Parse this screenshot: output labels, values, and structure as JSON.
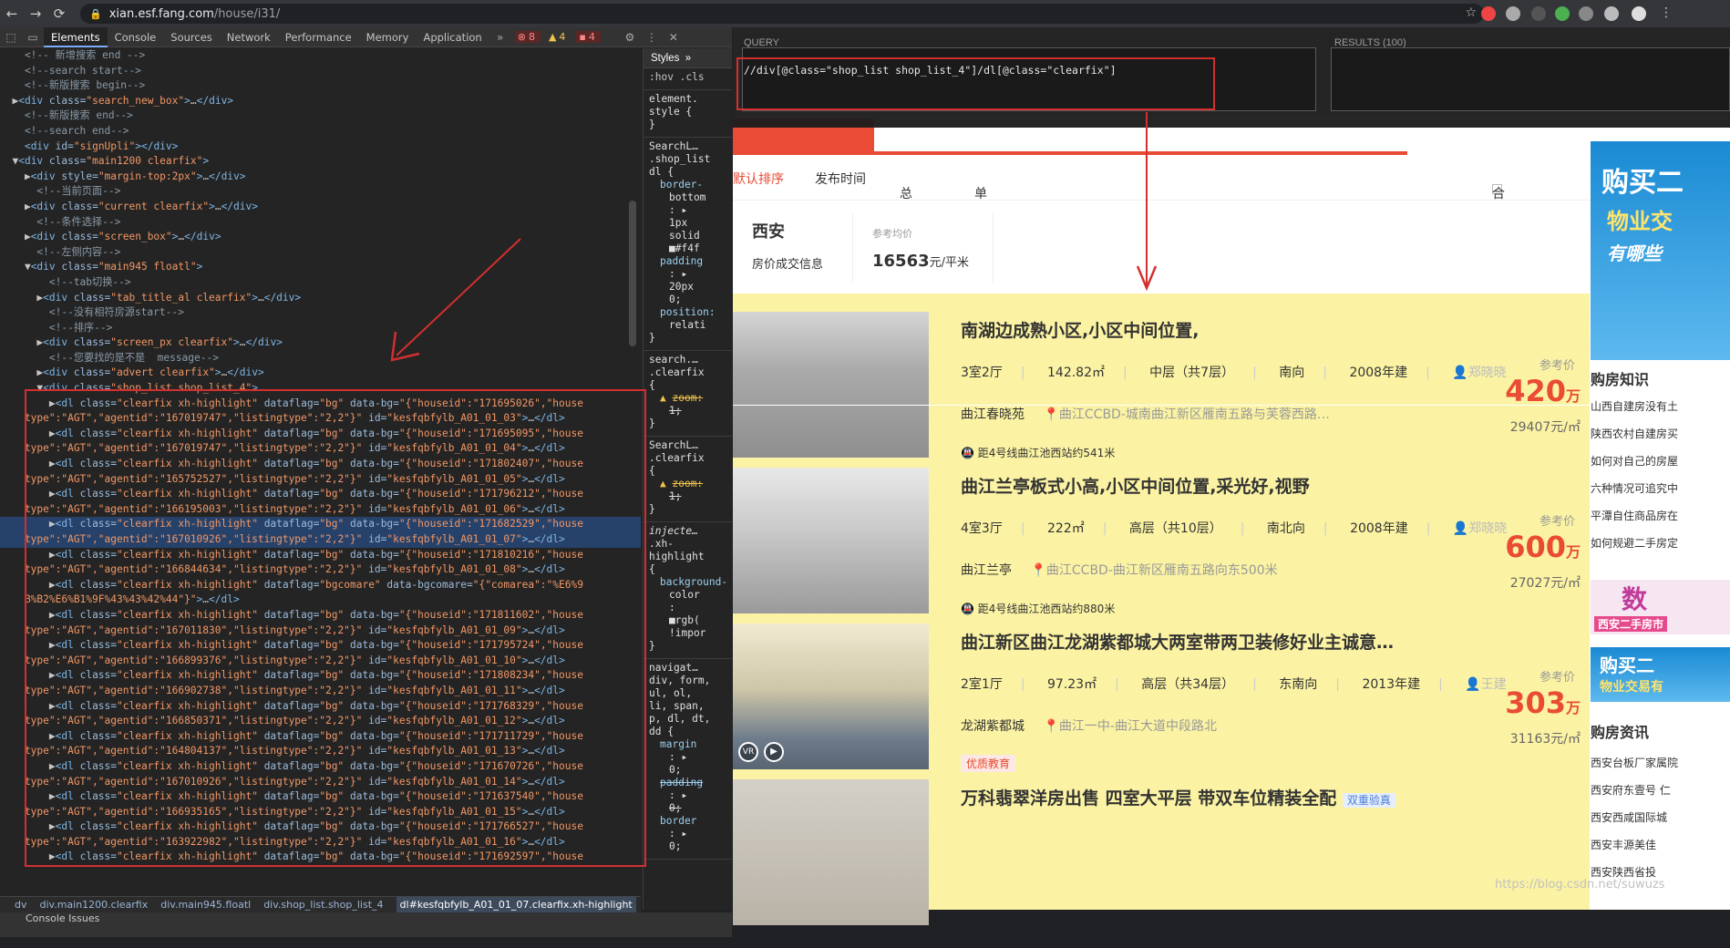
{
  "browser": {
    "url_host": "xian.esf.fang.com",
    "url_path": "/house/i31/"
  },
  "devtools": {
    "tabs": [
      "Elements",
      "Console",
      "Sources",
      "Network",
      "Performance",
      "Memory",
      "Application"
    ],
    "errors": "8",
    "warnings": "4",
    "issues": "4",
    "styles_tab": "Styles",
    "styles_toolbar": ":hov .cls",
    "crumbs": [
      "dv",
      "div.main1200.clearfix",
      "div.main945.floatl",
      "div.shop_list.shop_list_4",
      "dl#kesfqbfylb_A01_01_07.clearfix.xh-highlight"
    ],
    "console_tabs": "Console   Issues"
  },
  "xpath_helper": {
    "query_label": "QUERY",
    "results_label": "RESULTS (100)",
    "query": "//div[@class=\"shop_list shop_list_4\"]/dl[@class=\"clearfix\"]"
  },
  "page": {
    "sort_items": [
      "默认排序",
      "发布时间",
      "总价",
      "单价"
    ],
    "merge_label": "合并相似房源",
    "city": "西安",
    "deal_info": "房价成交信息",
    "avg_label": "参考均价",
    "avg_value": "16563",
    "avg_unit": "元/平米",
    "price_label": "参考价",
    "listings": [
      {
        "title": "南湖边成熟小区,小区中间位置,",
        "layout": "3室2厅",
        "area": "142.82㎡",
        "floor": "中层（共7层）",
        "facing": "南向",
        "year": "2008年建",
        "agent": "郑晓晓",
        "estate": "曲江春晓苑",
        "address": "曲江CCBD-城南曲江新区雁南五路与芙蓉西路…",
        "subway": "距4号线曲江池西站约541米",
        "price": "420",
        "price_unit": "万",
        "unit_price": "29407元/㎡"
      },
      {
        "title": "曲江兰亭板式小高,小区中间位置,采光好,视野",
        "layout": "4室3厅",
        "area": "222㎡",
        "floor": "高层（共10层）",
        "facing": "南北向",
        "year": "2008年建",
        "agent": "郑晓晓",
        "estate": "曲江兰亭",
        "address": "曲江CCBD-曲江新区雁南五路向东500米",
        "subway": "距4号线曲江池西站约880米",
        "price": "600",
        "price_unit": "万",
        "unit_price": "27027元/㎡"
      },
      {
        "title": "曲江新区曲江龙湖紫都城大两室带两卫装修好业主诚意…",
        "layout": "2室1厅",
        "area": "97.23㎡",
        "floor": "高层（共34层）",
        "facing": "东南向",
        "year": "2013年建",
        "agent": "王建",
        "estate": "龙湖紫都城",
        "address": "曲江一中-曲江大道中段路北",
        "tag": "优质教育",
        "price": "303",
        "price_unit": "万",
        "unit_price": "31163元/㎡"
      },
      {
        "title": "万科翡翠洋房出售 四室大平层 带双车位精装全配",
        "badge": "双重验真"
      }
    ]
  },
  "sidebar": {
    "ad1_line1": "购买二",
    "ad1_line2": "物业交",
    "ad1_line3": "有哪些",
    "knowledge_title": "购房知识",
    "knowledge_links": [
      "山西自建房没有土",
      "陕西农村自建房买",
      "如何对自己的房屋",
      "六种情况可追究中",
      "平潭自住商品房在",
      "如何规避二手房定"
    ],
    "ad2_text": "数",
    "ad2_sub": "西安二手房市",
    "ad3_line1": "购买二",
    "ad3_line2": "物业交易有",
    "news_title": "购房资讯",
    "news_links": [
      "西安台板厂家属院",
      "西安府东壹号 仁",
      "西安西咸国际城",
      "西安丰源美佳",
      "西安陕西省投"
    ]
  },
  "watermark": "https://blog.csdn.net/suwuzs"
}
